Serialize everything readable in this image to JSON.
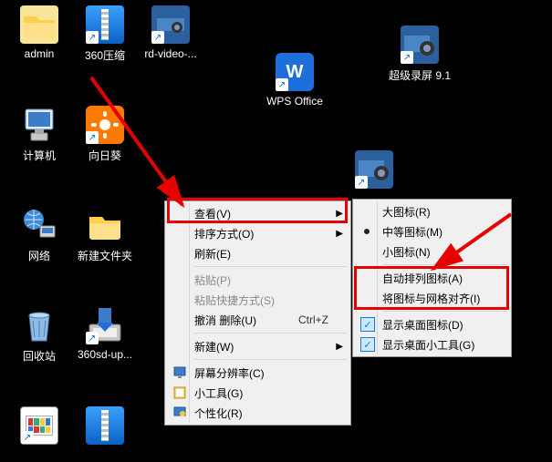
{
  "icons": {
    "admin": {
      "label": "admin"
    },
    "zip360": {
      "label": "360压缩"
    },
    "rdvideo": {
      "label": "rd-video-..."
    },
    "wps": {
      "label": "WPS Office"
    },
    "superrec": {
      "label": "超级录屏 9.1"
    },
    "computer": {
      "label": "计算机"
    },
    "sunflower": {
      "label": "向日葵"
    },
    "network": {
      "label": "网络"
    },
    "newfolder": {
      "label": "新建文件夹"
    },
    "recycle": {
      "label": "回收站"
    },
    "sdup": {
      "label": "360sd-up..."
    },
    "bottom1": {
      "label": ""
    },
    "bottom2": {
      "label": ""
    }
  },
  "menu1": {
    "view": "查看(V)",
    "sort": "排序方式(O)",
    "refresh": "刷新(E)",
    "paste": "粘贴(P)",
    "pasteShort": "粘贴快捷方式(S)",
    "undo": "撤消 删除(U)",
    "undoKey": "Ctrl+Z",
    "new": "新建(W)",
    "resolution": "屏幕分辨率(C)",
    "gadgets": "小工具(G)",
    "personalize": "个性化(R)"
  },
  "menu2": {
    "large": "大图标(R)",
    "medium": "中等图标(M)",
    "small": "小图标(N)",
    "auto": "自动排列图标(A)",
    "align": "将图标与网格对齐(I)",
    "showIcons": "显示桌面图标(D)",
    "showGadgets": "显示桌面小工具(G)"
  },
  "colors": {
    "highlight": "#e60000"
  }
}
